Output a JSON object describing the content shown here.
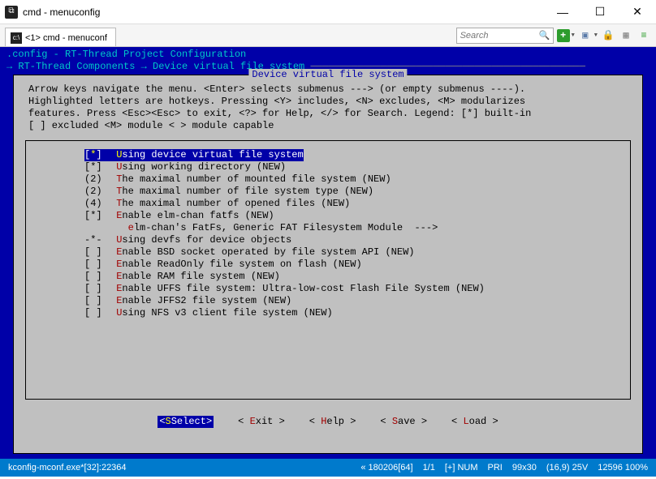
{
  "window": {
    "title": "cmd - menuconfig",
    "tab_label": "<1> cmd - menuconf",
    "search_placeholder": "Search"
  },
  "config": {
    "header": ".config - RT-Thread Project Configuration",
    "breadcrumb": "→ RT-Thread Components → Device virtual file system",
    "box_title": " Device virtual file system ",
    "help_line1": "Arrow keys navigate the menu.  <Enter> selects submenus ---> (or empty submenus ----).",
    "help_line2": "Highlighted letters are hotkeys.  Pressing <Y> includes, <N> excludes, <M> modularizes",
    "help_line3": "features.  Press <Esc><Esc> to exit, <?> for Help, </> for Search.  Legend: [*] built-in",
    "help_line4": "[ ] excluded  <M> module  < > module capable"
  },
  "items": [
    {
      "prefix": "[*]",
      "hotkey": "U",
      "text": "sing device virtual file system",
      "suffix": "",
      "selected": true
    },
    {
      "prefix": "[*]",
      "hotkey": "U",
      "text": "sing working directory (NEW)",
      "suffix": ""
    },
    {
      "prefix": "(2)",
      "hotkey": "T",
      "text": "he maximal number of mounted file system (NEW)",
      "suffix": ""
    },
    {
      "prefix": "(2)",
      "hotkey": "T",
      "text": "he maximal number of file system type (NEW)",
      "suffix": ""
    },
    {
      "prefix": "(4)",
      "hotkey": "T",
      "text": "he maximal number of opened files (NEW)",
      "suffix": ""
    },
    {
      "prefix": "[*]",
      "hotkey": "E",
      "text": "nable elm-chan fatfs (NEW)",
      "suffix": ""
    },
    {
      "prefix": "   ",
      "hotkey": "e",
      "text": "lm-chan's FatFs, Generic FAT Filesystem Module  --->",
      "suffix": "",
      "indent": true
    },
    {
      "prefix": "-*-",
      "hotkey": "U",
      "text": "sing devfs for device objects",
      "suffix": ""
    },
    {
      "prefix": "[ ]",
      "hotkey": "E",
      "text": "nable BSD socket operated by file system API (NEW)",
      "suffix": ""
    },
    {
      "prefix": "[ ]",
      "hotkey": "E",
      "text": "nable ReadOnly file system on flash (NEW)",
      "suffix": ""
    },
    {
      "prefix": "[ ]",
      "hotkey": "E",
      "text": "nable RAM file system (NEW)",
      "suffix": ""
    },
    {
      "prefix": "[ ]",
      "hotkey": "E",
      "text": "nable UFFS file system: Ultra-low-cost Flash File System (NEW)",
      "suffix": ""
    },
    {
      "prefix": "[ ]",
      "hotkey": "E",
      "text": "nable JFFS2 file system (NEW)",
      "suffix": ""
    },
    {
      "prefix": "[ ]",
      "hotkey": "U",
      "text": "sing NFS v3 client file system (NEW)",
      "suffix": ""
    }
  ],
  "buttons": {
    "select": "Select",
    "exit": "xit",
    "exit_hk": "E",
    "help": "elp",
    "help_hk": "H",
    "save": "ave",
    "save_hk": "S",
    "load": "oad",
    "load_hk": "L"
  },
  "status": {
    "left": "kconfig-mconf.exe*[32]:22364",
    "items": [
      "« 180206[64]",
      "1/1",
      "[+] NUM",
      "PRI",
      "99x30",
      "(16,9) 25V",
      "12596 100%"
    ]
  }
}
